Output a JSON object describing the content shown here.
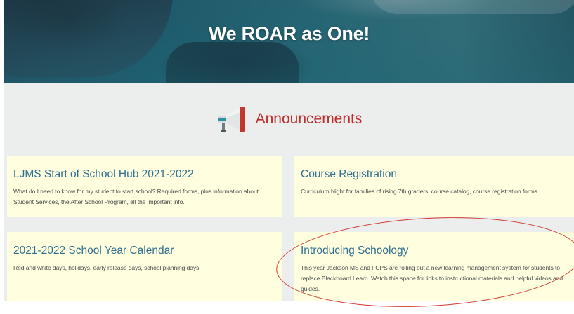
{
  "hero": {
    "title": "We ROAR as One!"
  },
  "announcements": {
    "title": "Announcements",
    "icon": "megaphone-icon"
  },
  "cards": [
    {
      "title": "LJMS Start of School Hub 2021-2022",
      "description": "What do I need to know for my student to start school? Required forms, plus information about Student Services, the After School Program, all the important info."
    },
    {
      "title": "Course Registration",
      "description": "Curriculum Night for families of rising 7th graders, course catalog, course registration forms"
    },
    {
      "title": "2021-2022 School Year Calendar",
      "description": "Red and white days, holidays, early release days, school planning days"
    },
    {
      "title": "Introducing Schoology",
      "description": "This year Jackson MS and FCPS are rolling out a new learning management system for students to replace Blackboard Learn. Watch this space for links to instructional materials and helpful videos and guides."
    }
  ],
  "colors": {
    "accent_red": "#c12a2a",
    "card_title_blue": "#2f6f8f",
    "card_background": "#ffffe0",
    "annotation_circle": "#d23a30"
  }
}
